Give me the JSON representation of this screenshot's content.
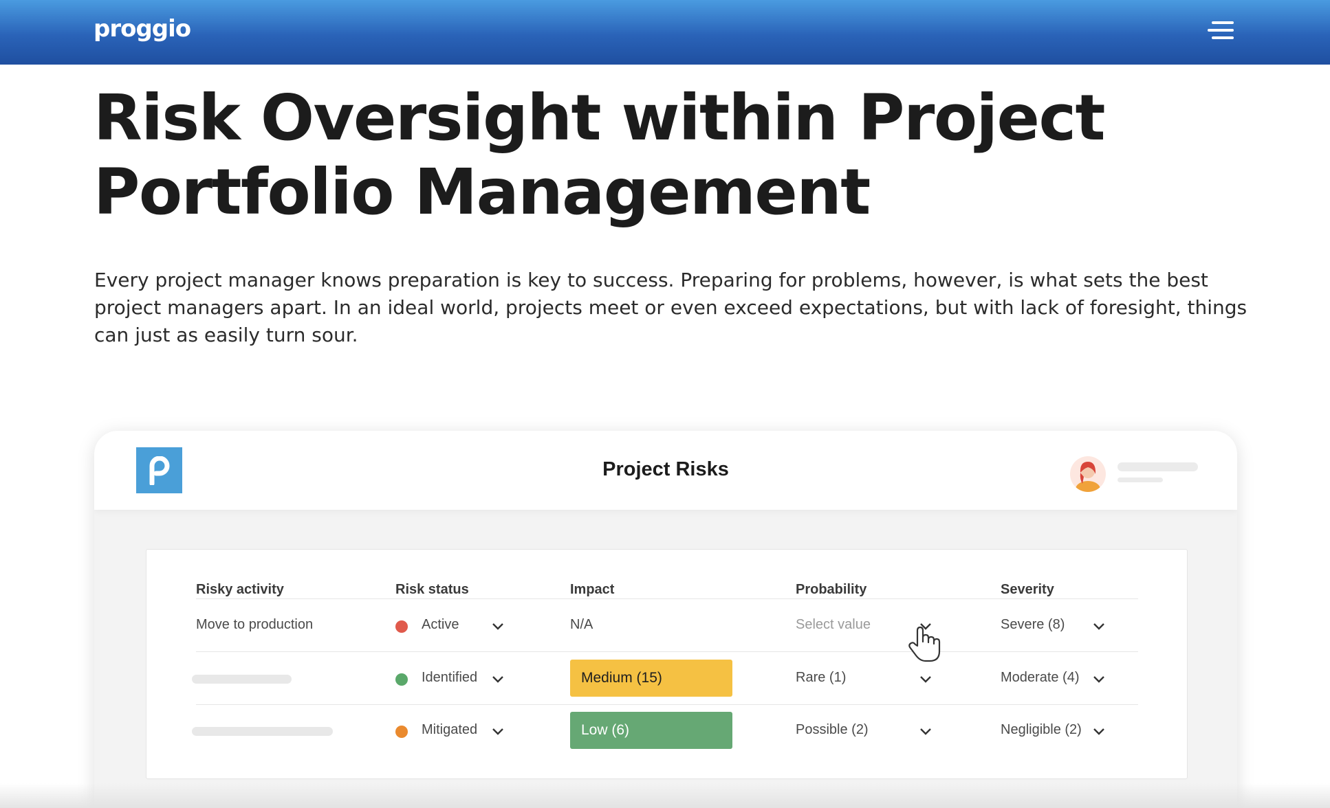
{
  "brand": {
    "logo_text": "proggio"
  },
  "nav": {
    "menu_icon": "hamburger-menu-icon"
  },
  "hero": {
    "title": "Risk Oversight within Project Portfolio Management",
    "paragraph": "Every project manager knows preparation is key to success. Preparing for problems, however, is what sets the best project managers apart. In an ideal world, projects meet or even exceed expectations, but with lack of foresight, things can just as easily turn sour."
  },
  "app": {
    "logo_letter": "p",
    "title": "Project Risks",
    "table": {
      "headers": {
        "activity": "Risky activity",
        "status": "Risk status",
        "impact": "Impact",
        "probability": "Probability",
        "severity": "Severity"
      },
      "rows": [
        {
          "activity": "Move to production",
          "status": "Active",
          "status_color": "#e05a4c",
          "impact": "N/A",
          "probability": "Select value",
          "severity": "Severe (8)"
        },
        {
          "activity": "",
          "status": "Identified",
          "status_color": "#5aa86a",
          "impact": "Medium (15)",
          "impact_color": "#f5c143",
          "probability": "Rare (1)",
          "severity": "Moderate (4)"
        },
        {
          "activity": "",
          "status": "Mitigated",
          "status_color": "#ea8a2e",
          "impact": "Low (6)",
          "impact_color": "#66a874",
          "probability": "Possible (2)",
          "severity": "Negligible (2)"
        }
      ]
    }
  },
  "colors": {
    "nav_gradient_top": "#4a9be0",
    "nav_gradient_bottom": "#1f4fa0",
    "app_logo": "#4a9fd8"
  }
}
